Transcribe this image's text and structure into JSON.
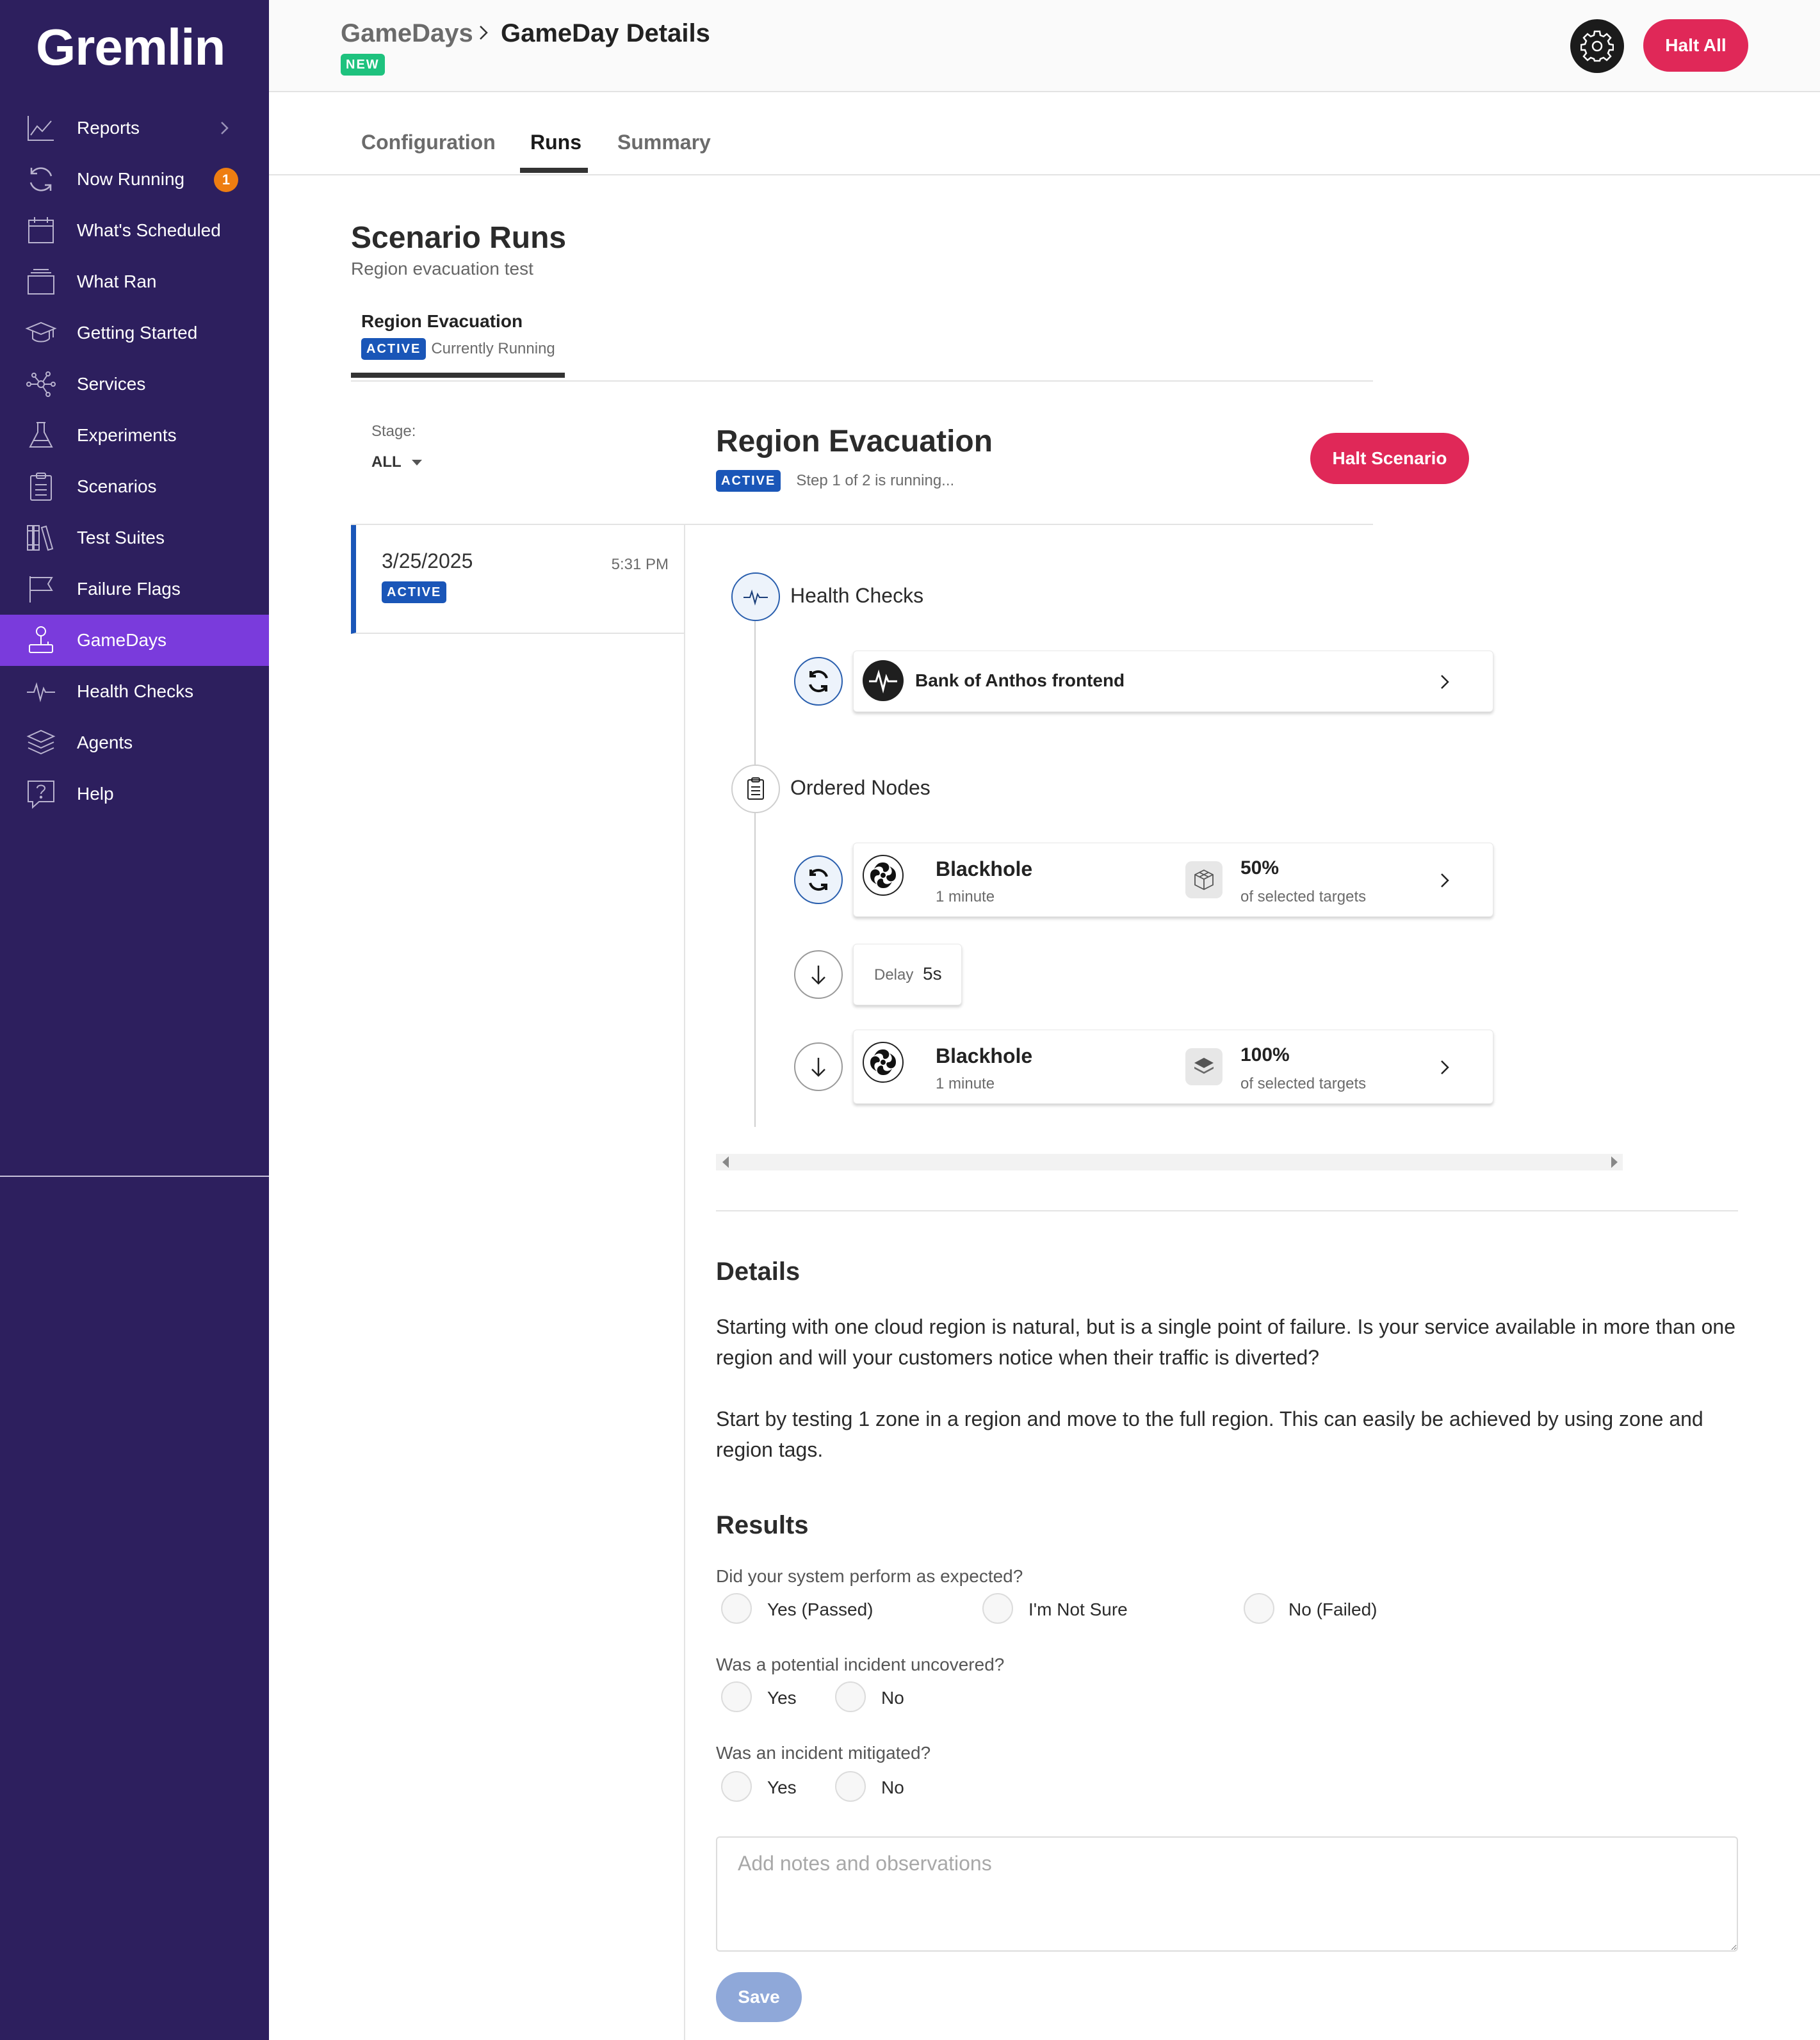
{
  "app": {
    "logo": "Gremlin"
  },
  "sidebar": {
    "items": [
      {
        "label": "Reports",
        "icon": "chart-line-icon"
      },
      {
        "label": "Now Running",
        "icon": "refresh-icon",
        "badge": "1"
      },
      {
        "label": "What's Scheduled",
        "icon": "calendar-icon"
      },
      {
        "label": "What Ran",
        "icon": "stack-icon"
      },
      {
        "label": "Getting Started",
        "icon": "graduation-cap-icon"
      },
      {
        "label": "Services",
        "icon": "network-icon"
      },
      {
        "label": "Experiments",
        "icon": "flask-icon"
      },
      {
        "label": "Scenarios",
        "icon": "clipboard-icon"
      },
      {
        "label": "Test Suites",
        "icon": "books-icon"
      },
      {
        "label": "Failure Flags",
        "icon": "flag-icon"
      },
      {
        "label": "GameDays",
        "icon": "joystick-icon",
        "active": true
      },
      {
        "label": "Health Checks",
        "icon": "pulse-icon"
      },
      {
        "label": "Agents",
        "icon": "layers-icon"
      },
      {
        "label": "Help",
        "icon": "help-icon"
      }
    ]
  },
  "header": {
    "breadcrumb_root": "GameDays",
    "breadcrumb_current": "GameDay Details",
    "new_badge": "NEW",
    "halt_all": "Halt All"
  },
  "tabs": [
    {
      "label": "Configuration"
    },
    {
      "label": "Runs",
      "active": true
    },
    {
      "label": "Summary"
    }
  ],
  "scenario_runs": {
    "title": "Scenario Runs",
    "subtitle": "Region evacuation test",
    "tab": {
      "name": "Region Evacuation",
      "badge": "ACTIVE",
      "status": "Currently Running"
    }
  },
  "stage": {
    "label": "Stage:",
    "value": "ALL"
  },
  "run": {
    "date": "3/25/2025",
    "time": "5:31 PM",
    "badge": "ACTIVE"
  },
  "detail": {
    "title": "Region Evacuation",
    "badge": "ACTIVE",
    "status": "Step 1 of 2 is running...",
    "halt_button": "Halt Scenario"
  },
  "timeline": {
    "health_checks": {
      "label": "Health Checks",
      "card": {
        "title": "Bank of Anthos frontend"
      }
    },
    "ordered_nodes": {
      "label": "Ordered Nodes",
      "nodes": [
        {
          "title": "Blackhole",
          "duration": "1 minute",
          "percent": "50%",
          "target_label": "of selected targets"
        },
        {
          "delay_label": "Delay",
          "delay_value": "5s"
        },
        {
          "title": "Blackhole",
          "duration": "1 minute",
          "percent": "100%",
          "target_label": "of selected targets"
        }
      ]
    }
  },
  "details": {
    "heading": "Details",
    "paragraph1": "Starting with one cloud region is natural, but is a single point of failure. Is your service available in more than one region and will your customers notice when their traffic is diverted?",
    "paragraph2": "Start by testing 1 zone in a region and move to the full region. This can easily be achieved by using zone and region tags."
  },
  "results": {
    "heading": "Results",
    "q1": {
      "label": "Did your system perform as expected?",
      "options": [
        "Yes (Passed)",
        "I'm Not Sure",
        "No (Failed)"
      ]
    },
    "q2": {
      "label": "Was a potential incident uncovered?",
      "options": [
        "Yes",
        "No"
      ]
    },
    "q3": {
      "label": "Was an incident mitigated?",
      "options": [
        "Yes",
        "No"
      ]
    },
    "notes_placeholder": "Add notes and observations",
    "save": "Save"
  },
  "colors": {
    "sidebar_bg": "#2d1f5e",
    "sidebar_active": "#7a3bdc",
    "primary_red": "#e02858",
    "active_blue": "#1a56b8",
    "new_green": "#1ec27e",
    "badge_orange": "#ee7d11"
  }
}
